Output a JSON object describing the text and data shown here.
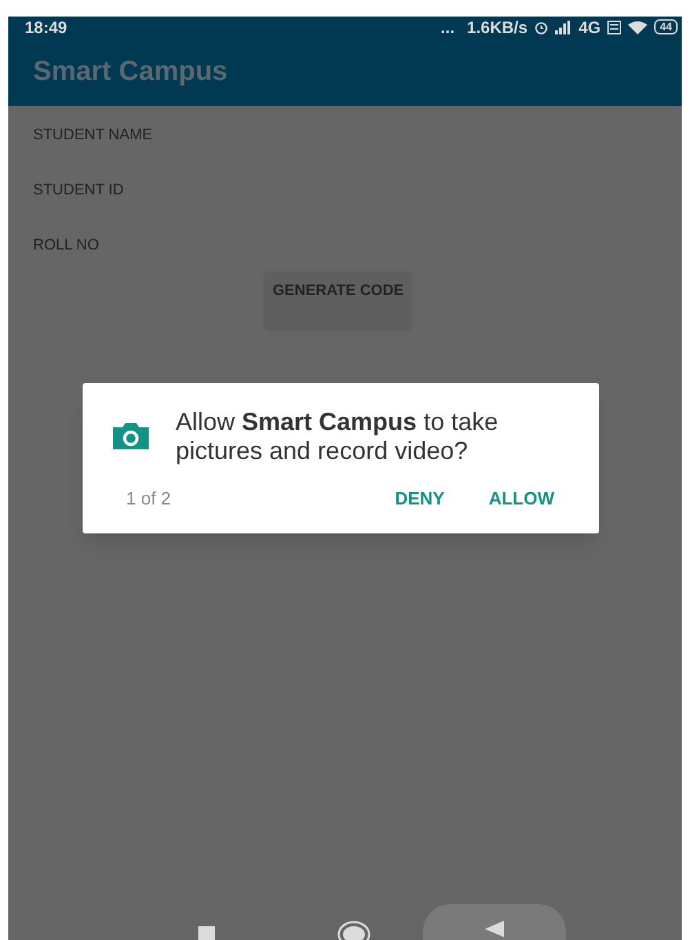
{
  "status_bar": {
    "time": "18:49",
    "dots": "...",
    "speed": "1.6KB/s",
    "network": "4G",
    "battery": "44"
  },
  "app_bar": {
    "title": "Smart Campus"
  },
  "form": {
    "labels": [
      "STUDENT NAME",
      "STUDENT ID",
      "ROLL NO"
    ],
    "button": "GENERATE CODE"
  },
  "dialog": {
    "message": "Allow **Smart Campus** to take pictures and record video?",
    "counter": "1 of 2",
    "buttons": [
      "DENY",
      "ALLOW"
    ]
  }
}
